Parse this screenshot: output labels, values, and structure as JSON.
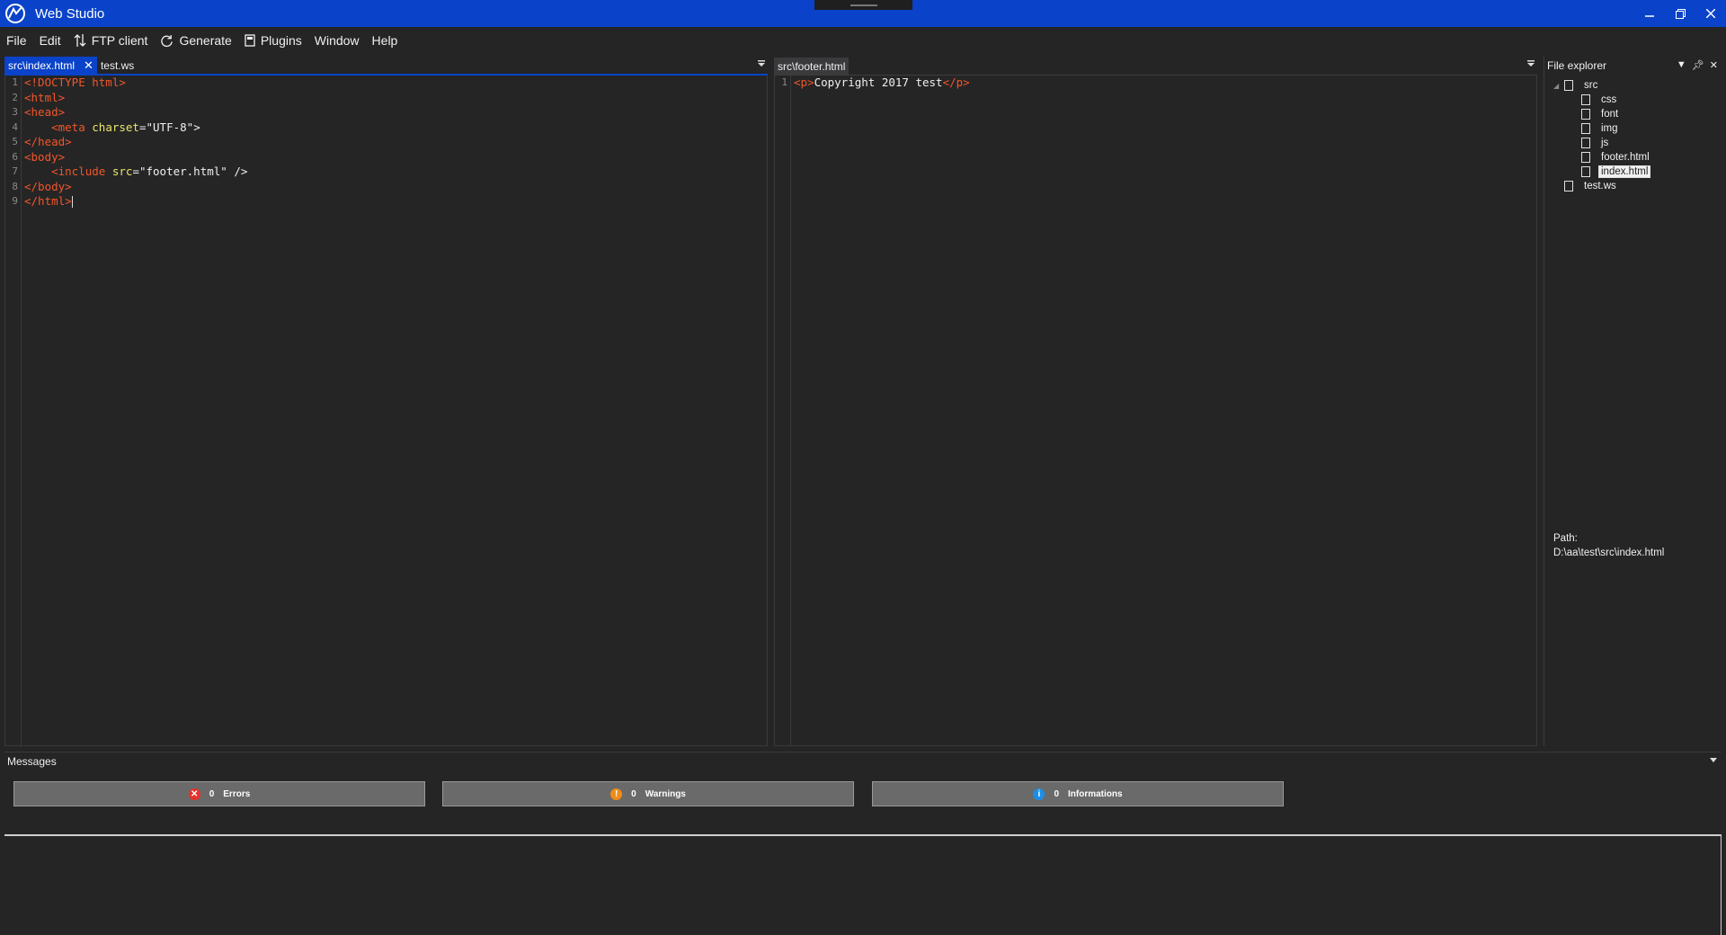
{
  "window": {
    "title": "Web Studio",
    "icon": "web-studio-logo",
    "controls": [
      "minimize",
      "restore",
      "close"
    ]
  },
  "menu": {
    "file": "File",
    "edit": "Edit",
    "ftp": "FTP client",
    "generate": "Generate",
    "plugins": "Plugins",
    "window": "Window",
    "help": "Help"
  },
  "left_pane": {
    "tabs": [
      {
        "label": "src\\index.html",
        "active": true,
        "closable": true
      },
      {
        "label": "test.ws",
        "active": false
      }
    ],
    "line_numbers": [
      "1",
      "2",
      "3",
      "4",
      "5",
      "6",
      "7",
      "8",
      "9"
    ],
    "code": {
      "l1": "<!DOCTYPE html>",
      "l2": "<html>",
      "l3": "<head>",
      "l4_tag_open": "<meta",
      "l4_attr": " charset",
      "l4_eq": "=",
      "l4_val": "\"UTF-8\"",
      "l4_close": ">",
      "l5": "</head>",
      "l6": "<body>",
      "l7_tag": "<include",
      "l7_attr": " src",
      "l7_eq": "=",
      "l7_val": "\"footer.html\"",
      "l7_close": " />",
      "l8": "</body>",
      "l9": "</html>"
    }
  },
  "right_pane": {
    "tabs": [
      {
        "label": "src\\footer.html",
        "active": true
      }
    ],
    "line_numbers": [
      "1"
    ],
    "code": {
      "l1_open": "<p>",
      "l1_text": "Copyright 2017 test",
      "l1_close": "</p>"
    }
  },
  "explorer": {
    "title": "File explorer",
    "items": [
      {
        "label": "src",
        "level": 0,
        "type": "folder"
      },
      {
        "label": "css",
        "level": 1,
        "type": "folder"
      },
      {
        "label": "font",
        "level": 1,
        "type": "folder"
      },
      {
        "label": "img",
        "level": 1,
        "type": "folder"
      },
      {
        "label": "js",
        "level": 1,
        "type": "folder"
      },
      {
        "label": "footer.html",
        "level": 1,
        "type": "file"
      },
      {
        "label": "index.html",
        "level": 1,
        "type": "file",
        "selected": true
      },
      {
        "label": "test.ws",
        "level": 0,
        "type": "file"
      }
    ],
    "path_label": "Path:",
    "path_value": "D:\\aa\\test\\src\\index.html"
  },
  "messages": {
    "title": "Messages",
    "errors": {
      "count": "0",
      "label": "Errors",
      "color": "#e8312a"
    },
    "warnings": {
      "count": "0",
      "label": "Warnings",
      "color": "#f08c1a"
    },
    "informations": {
      "count": "0",
      "label": "Informations",
      "color": "#1c8ee8"
    }
  },
  "colors": {
    "accent": "#0a43c9",
    "background": "#252526",
    "tag": "#f0572a",
    "attribute": "#e9e66a"
  }
}
